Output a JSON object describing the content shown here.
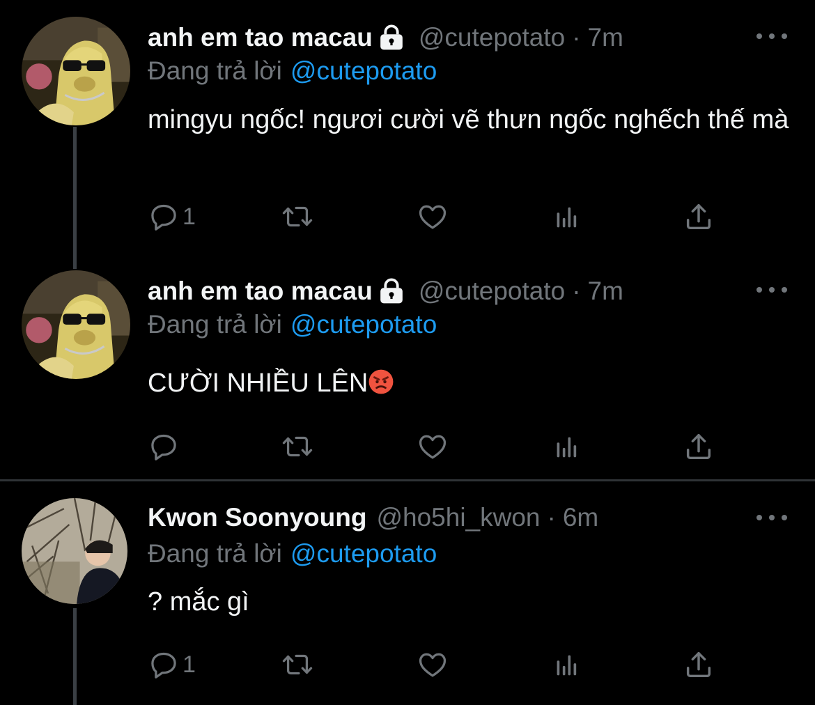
{
  "tweets": [
    {
      "name": "anh em tao macau",
      "handle": "@cutepotato",
      "time": "7m",
      "replying_label": "Đang trả lời",
      "replying_to": "@cutepotato",
      "text": "mingyu ngốc! ngươi cười vẽ thưn ngốc nghếch thế mà",
      "reply_count": "1",
      "protected": true,
      "avatar": "dog-with-sunglasses-avatar"
    },
    {
      "name": "anh em tao macau",
      "handle": "@cutepotato",
      "time": "7m",
      "replying_label": "Đang trả lời",
      "replying_to": "@cutepotato",
      "text": "CƯỜI NHIỀU LÊN",
      "emoji": "angry-face-emoji",
      "reply_count": "",
      "protected": true,
      "avatar": "dog-with-sunglasses-avatar"
    },
    {
      "name": "Kwon Soonyoung",
      "handle": "@ho5hi_kwon",
      "time": "6m",
      "replying_label": "Đang trả lời",
      "replying_to": "@cutepotato",
      "text": "? mắc gì",
      "reply_count": "1",
      "protected": false,
      "avatar": "person-in-forest-avatar"
    }
  ],
  "separator": "·",
  "icons": {
    "reply": "speech-bubble-icon",
    "retweet": "retweet-arrows-icon",
    "like": "heart-icon",
    "views": "bar-chart-icon",
    "share": "share-upload-icon",
    "more": "ellipsis-icon",
    "lock": "lock-icon"
  },
  "colors": {
    "background": "#000000",
    "text": "#e7e9ea",
    "secondary": "#71767b",
    "link": "#1d9bf0",
    "thread_line": "#3a3f44",
    "divider": "#2f3336"
  }
}
